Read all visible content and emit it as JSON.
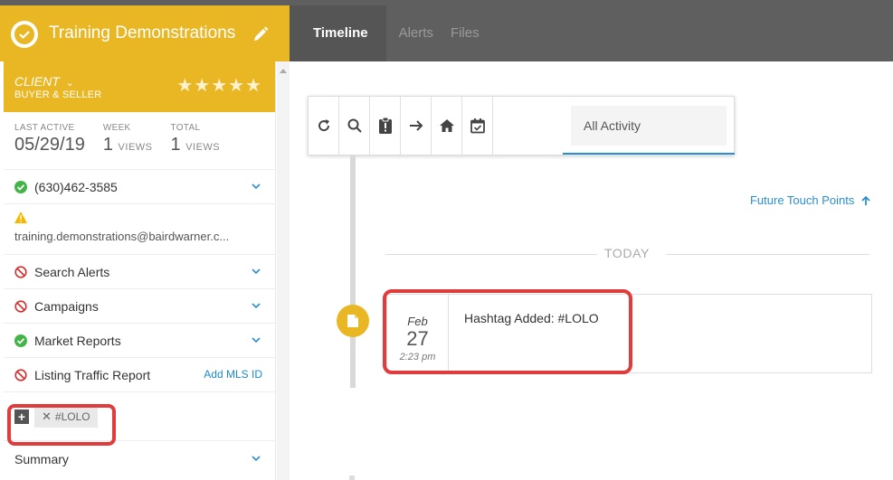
{
  "header": {
    "contact_name": "Training Demonstrations",
    "brand_color": "#e8b723",
    "tabs": [
      {
        "label": "Timeline",
        "active": true
      },
      {
        "label": "Alerts",
        "active": false
      },
      {
        "label": "Files",
        "active": false
      }
    ]
  },
  "sidebar": {
    "client_label": "CLIENT",
    "client_type": "BUYER & SELLER",
    "stars": "★★★★★",
    "stats": [
      {
        "label": "LAST ACTIVE",
        "value": "05/29/19",
        "unit": ""
      },
      {
        "label": "WEEK",
        "value": "1",
        "unit": "VIEWS"
      },
      {
        "label": "TOTAL",
        "value": "1",
        "unit": "VIEWS"
      }
    ],
    "phone": "(630)462-3585",
    "email": "training.demonstrations@bairdwarner.c...",
    "items": [
      {
        "label": "Search Alerts",
        "status": "blocked"
      },
      {
        "label": "Campaigns",
        "status": "blocked"
      },
      {
        "label": "Market Reports",
        "status": "ok"
      },
      {
        "label": "Listing Traffic Report",
        "status": "blocked",
        "action": "Add MLS ID"
      }
    ],
    "tag": "#LOLO",
    "summary_label": "Summary"
  },
  "main": {
    "filter_label": "All Activity",
    "future_link": "Future Touch Points",
    "today_label": "TODAY",
    "event": {
      "month": "Feb",
      "day": "27",
      "time": "2:23 pm",
      "text": "Hashtag Added: #LOLO"
    }
  },
  "colors": {
    "accent": "#e8b723",
    "link": "#2a8fd0",
    "success": "#43b548",
    "danger": "#d32f2f",
    "highlight": "#e23b3b"
  }
}
